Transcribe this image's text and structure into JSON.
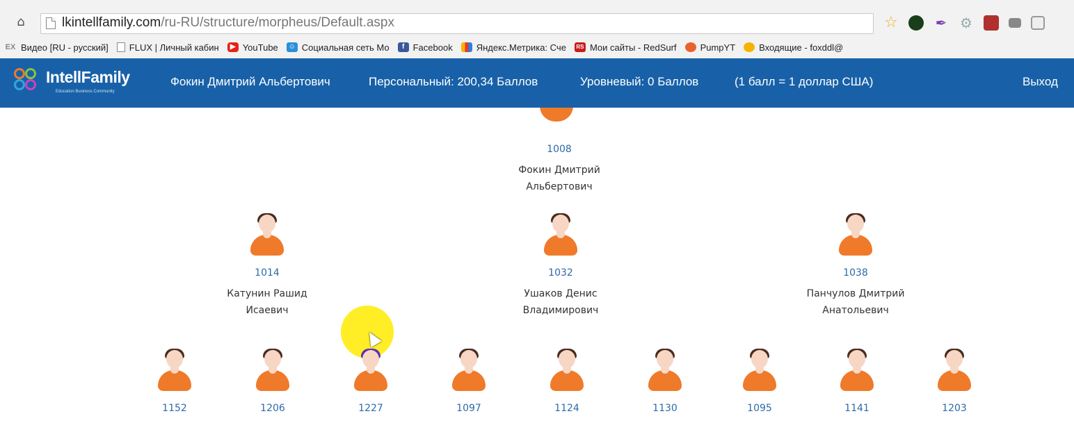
{
  "browser": {
    "url_host": "lkintellfamily.com",
    "url_path": "/ru-RU/structure/morpheus/Default.aspx",
    "bookmarks": [
      {
        "label": "Видео [RU - русский]",
        "icon": "ex-icon"
      },
      {
        "label": "FLUX | Личный кабин",
        "icon": "page-icon"
      },
      {
        "label": "YouTube",
        "icon": "youtube-icon"
      },
      {
        "label": "Социальная сеть Мо",
        "icon": "smile-icon"
      },
      {
        "label": "Facebook",
        "icon": "facebook-icon"
      },
      {
        "label": "Яндекс.Метрика: Сче",
        "icon": "yandex-metrika-icon"
      },
      {
        "label": "Мои сайты - RedSurf",
        "icon": "redsurf-icon"
      },
      {
        "label": "PumpYT",
        "icon": "pumpyt-icon"
      },
      {
        "label": "Входящие - foxddl@",
        "icon": "mail-icon"
      }
    ]
  },
  "header": {
    "logo": "IntellFamily",
    "logo_sub": "Education Business Community",
    "user_name": "Фокин Дмитрий Альбертович",
    "personal": "Персональный: 200,34 Баллов",
    "level": "Уровневый: 0 Баллов",
    "rate": "(1 балл = 1 доллар США)",
    "exit": "Выход",
    "color": "#1861a8"
  },
  "tree": {
    "root": {
      "id": "1008",
      "name_line1": "Фокин Дмитрий",
      "name_line2": "Альбертович"
    },
    "level1": [
      {
        "id": "1014",
        "name_line1": "Катунин Рашид",
        "name_line2": "Исаевич"
      },
      {
        "id": "1032",
        "name_line1": "Ушаков Денис",
        "name_line2": "Владимирович"
      },
      {
        "id": "1038",
        "name_line1": "Панчулов Дмитрий",
        "name_line2": "Анатольевич"
      }
    ],
    "level2": [
      {
        "id": "1152"
      },
      {
        "id": "1206"
      },
      {
        "id": "1227"
      },
      {
        "id": "1097"
      },
      {
        "id": "1124"
      },
      {
        "id": "1130"
      },
      {
        "id": "1095"
      },
      {
        "id": "1141"
      },
      {
        "id": "1203"
      }
    ]
  }
}
